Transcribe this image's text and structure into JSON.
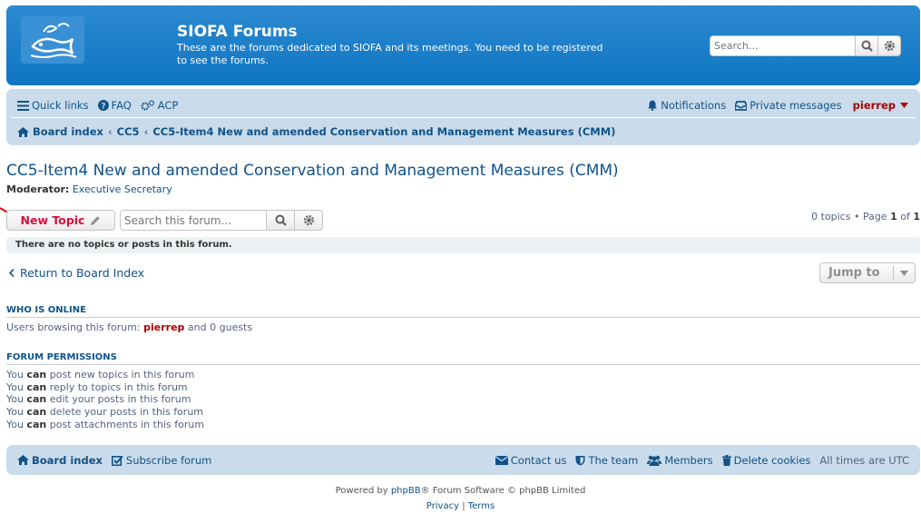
{
  "site": {
    "title": "SIOFA Forums",
    "description": "These are the forums dedicated to SIOFA and its meetings. You need to be registered to see the forums.",
    "search_placeholder": "Search…"
  },
  "nav": {
    "quick_links": "Quick links",
    "faq": "FAQ",
    "acp": "ACP",
    "notifications": "Notifications",
    "private_messages": "Private messages",
    "username": "pierrep"
  },
  "breadcrumb": {
    "items": [
      "Board index",
      "CC5",
      "CC5-Item4 New and amended Conservation and Management Measures (CMM)"
    ]
  },
  "forum": {
    "title": "CC5-Item4 New and amended Conservation and Management Measures (CMM)",
    "moderator_label": "Moderator:",
    "moderator_name": "Executive Secretary",
    "new_topic_label": "New Topic",
    "search_placeholder": "Search this forum…",
    "pagination_prefix": "0 topics • Page",
    "page_current": "1",
    "page_of": "of",
    "page_total": "1",
    "notice": "There are no topics or posts in this forum.",
    "return_label": "Return to Board Index",
    "jump_to_label": "Jump to"
  },
  "who_is_online": {
    "heading": "WHO IS ONLINE",
    "prefix": "Users browsing this forum:",
    "user": "pierrep",
    "suffix": "and 0 guests"
  },
  "permissions": {
    "heading": "FORUM PERMISSIONS",
    "word_you": "You",
    "word_can": "can",
    "items": [
      "post new topics in this forum",
      "reply to topics in this forum",
      "edit your posts in this forum",
      "delete your posts in this forum",
      "post attachments in this forum"
    ]
  },
  "footer": {
    "board_index": "Board index",
    "subscribe": "Subscribe forum",
    "contact": "Contact us",
    "team": "The team",
    "members": "Members",
    "delete_cookies": "Delete cookies",
    "timezone": "All times are UTC"
  },
  "powered": {
    "prefix": "Powered by",
    "phpbb": "phpBB",
    "suffix": "® Forum Software © phpBB Limited"
  },
  "policy": {
    "privacy": "Privacy",
    "separator": "|",
    "terms": "Terms"
  },
  "colors": {
    "header": "#1276c1",
    "nav_bg": "#cadceb",
    "link": "#105289",
    "new_topic": "#d31141",
    "username": "#aa0000",
    "annotation_arrow": "#e00000"
  }
}
